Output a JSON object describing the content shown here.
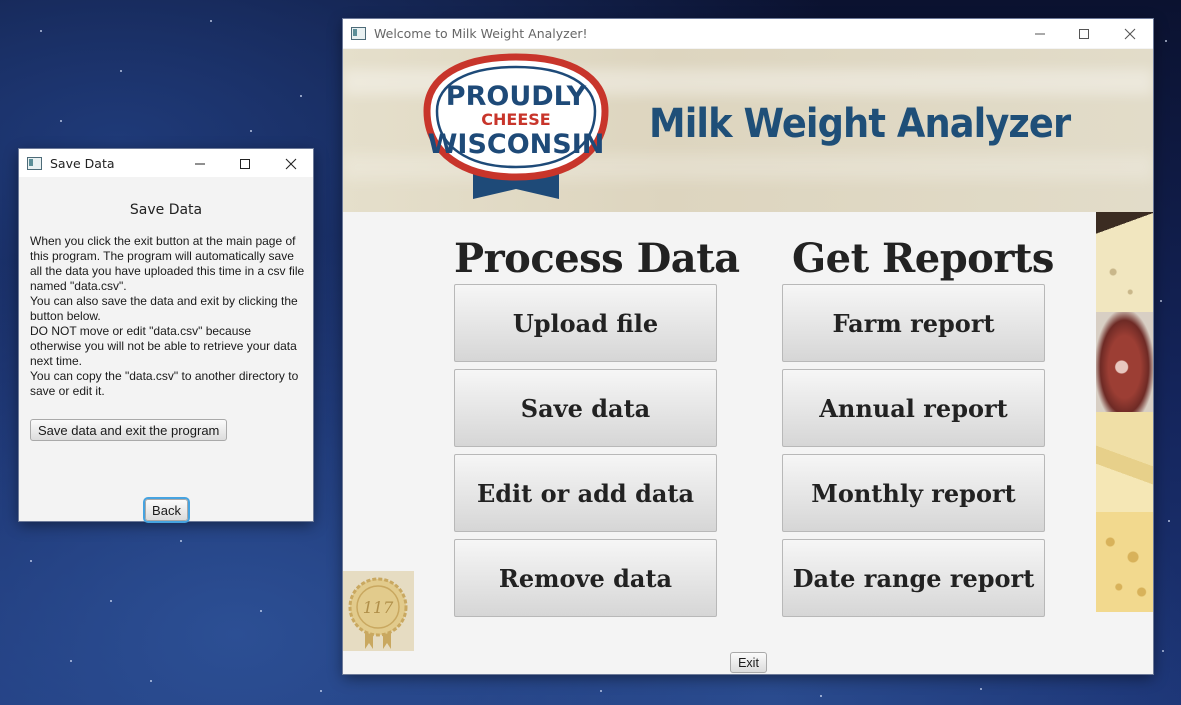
{
  "save_window": {
    "title": "Save Data",
    "heading": "Save Data",
    "paragraphs": [
      "When you click the exit button at the main page of this program. The program will automatically save all the data you have uploaded this time in a csv file named \"data.csv\".",
      "You can also save the data and exit by clicking the button below.",
      "DO NOT move or edit \"data.csv\" because otherwise you will not be able to retrieve your data next time.",
      "You can copy the \"data.csv\" to another directory to save or edit it."
    ],
    "save_exit_label": "Save data and exit the program",
    "back_label": "Back"
  },
  "main_window": {
    "title": "Welcome to Milk Weight Analyzer!",
    "banner_title": "Milk Weight Analyzer",
    "logo": {
      "line1": "PROUDLY",
      "line2": "CHEESE",
      "line3": "WISCONSIN"
    },
    "award_text": "117",
    "process_title": "Process Data",
    "reports_title": "Get Reports",
    "process_buttons": [
      "Upload file",
      "Save data",
      "Edit or add data",
      "Remove data"
    ],
    "report_buttons": [
      "Farm report",
      "Annual report",
      "Monthly report",
      "Date range report"
    ],
    "exit_label": "Exit"
  },
  "colors": {
    "banner_text": "#1f4f78",
    "logo_red": "#c8352b",
    "logo_navy": "#1e4a78",
    "focus_ring": "#46a3e0"
  }
}
